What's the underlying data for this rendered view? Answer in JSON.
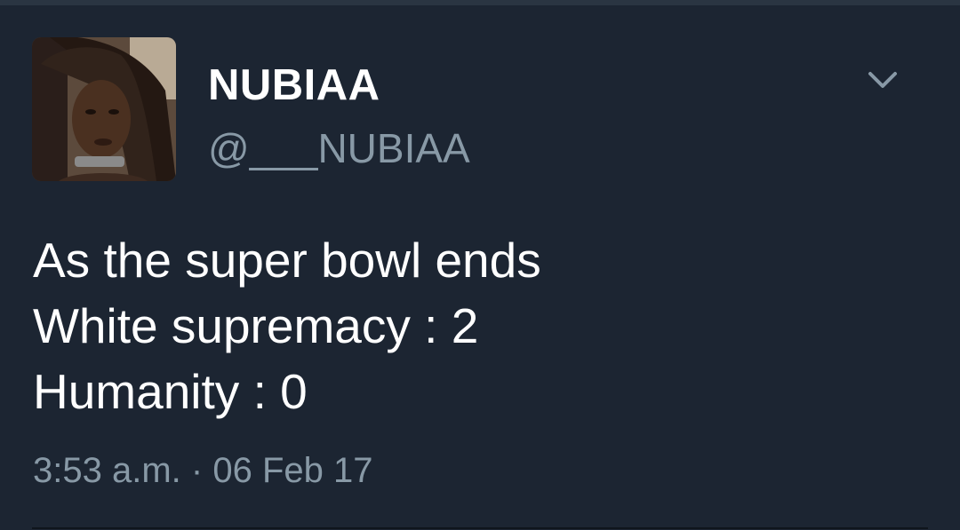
{
  "tweet": {
    "display_name": "NUBIAA",
    "handle": "@___NUBIAA",
    "text_lines": [
      "As the super bowl ends",
      "White supremacy : 2",
      "Humanity : 0"
    ],
    "time": "3:53 a.m.",
    "separator": "·",
    "date": "06 Feb 17"
  },
  "icons": {
    "menu": "chevron-down-icon",
    "avatar": "profile-avatar"
  },
  "colors": {
    "background": "#1c2532",
    "primary_text": "#ffffff",
    "secondary_text": "#8899a6"
  }
}
